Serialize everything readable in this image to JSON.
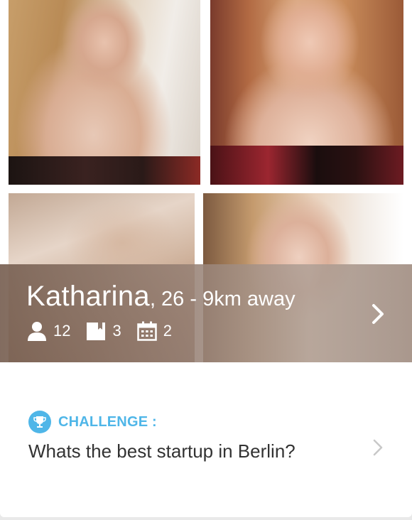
{
  "profile": {
    "name": "Katharina",
    "details": ", 26 - 9km away",
    "stats": [
      {
        "icon": "person-icon",
        "value": "12"
      },
      {
        "icon": "book-icon",
        "value": "3"
      },
      {
        "icon": "calendar-icon",
        "value": "2"
      }
    ]
  },
  "challenge": {
    "icon": "trophy-icon",
    "label": "CHALLENGE :",
    "question": "Whats the best startup in Berlin?"
  },
  "colors": {
    "accent": "#4fb6e8",
    "text": "#333333",
    "overlay_text": "#ffffff"
  }
}
